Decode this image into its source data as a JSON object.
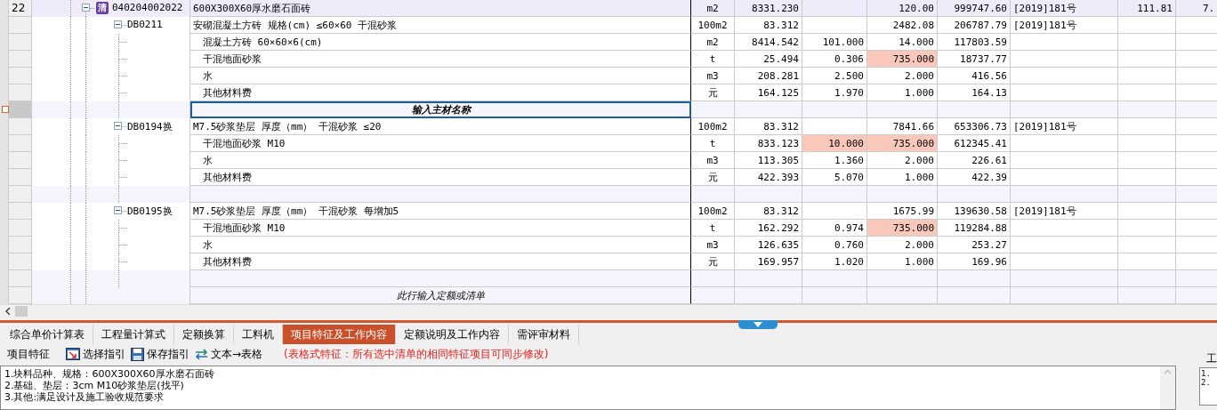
{
  "rows": [
    {
      "kind": "item",
      "row_number": "22",
      "badge": "清",
      "code": "040204002022",
      "expanded": true,
      "selected": false,
      "name": "600X300X60厚水磨石面砖",
      "unit": "m2",
      "quantity": "8331.230",
      "price": "120.00",
      "total": "999747.60",
      "document": "[2019]181号",
      "column_9": "111.81",
      "column_10": "7.",
      "children": [
        {
          "kind": "quota",
          "code": "DB0211",
          "expanded": true,
          "selected": false,
          "name": "安砌混凝土方砖 规格(cm) ≤60×60 干混砂浆",
          "unit": "100m2",
          "quantity": "83.312",
          "price": "2482.08",
          "total": "206787.79",
          "document": "[2019]181号",
          "children": [
            {
              "kind": "material",
              "selected": false,
              "name": "混凝土方砖 60×60×6(cm)",
              "unit": "m2",
              "quantity": "8414.542",
              "column_6": "101.000",
              "column_6_flagged": false,
              "price": "14.000",
              "price_flagged": false,
              "total": "117803.59"
            },
            {
              "kind": "material",
              "selected": false,
              "name": "干混地面砂浆",
              "unit": "t",
              "quantity": "25.494",
              "column_6": "0.306",
              "column_6_flagged": false,
              "price": "735.000",
              "price_flagged": true,
              "total": "18737.77"
            },
            {
              "kind": "material",
              "selected": false,
              "name": "水",
              "unit": "m3",
              "quantity": "208.281",
              "column_6": "2.500",
              "column_6_flagged": false,
              "price": "2.000",
              "price_flagged": false,
              "total": "416.56"
            },
            {
              "kind": "material",
              "selected": false,
              "name": "其他材料费",
              "unit": "元",
              "quantity": "164.125",
              "column_6": "1.970",
              "column_6_flagged": false,
              "price": "1.000",
              "price_flagged": false,
              "total": "164.13"
            },
            {
              "kind": "input",
              "selected": true,
              "name": "输入主材名称"
            }
          ]
        },
        {
          "kind": "quota",
          "code": "DB0194换",
          "expanded": true,
          "selected": false,
          "name": "M7.5砂浆垫层 厚度（mm） 干混砂浆 ≤20",
          "unit": "100m2",
          "quantity": "83.312",
          "price": "7841.66",
          "total": "653306.73",
          "document": "[2019]181号",
          "children": [
            {
              "kind": "material",
              "selected": false,
              "name": "干混地面砂浆 M10",
              "unit": "t",
              "quantity": "833.123",
              "column_6": "10.000",
              "column_6_flagged": true,
              "price": "735.000",
              "price_flagged": true,
              "total": "612345.41"
            },
            {
              "kind": "material",
              "selected": false,
              "name": "水",
              "unit": "m3",
              "quantity": "113.305",
              "column_6": "1.360",
              "column_6_flagged": false,
              "price": "2.000",
              "price_flagged": false,
              "total": "226.61"
            },
            {
              "kind": "material",
              "selected": false,
              "name": "其他材料费",
              "unit": "元",
              "quantity": "422.393",
              "column_6": "5.070",
              "column_6_flagged": false,
              "price": "1.000",
              "price_flagged": false,
              "total": "422.39"
            },
            {
              "kind": "blank",
              "selected": false
            }
          ]
        },
        {
          "kind": "quota",
          "code": "DB0195换",
          "expanded": true,
          "selected": false,
          "name": "M7.5砂浆垫层 厚度（mm） 干混砂浆 每增加5",
          "unit": "100m2",
          "quantity": "83.312",
          "price": "1675.99",
          "total": "139630.58",
          "document": "[2019]181号",
          "children": [
            {
              "kind": "material",
              "selected": false,
              "name": "干混地面砂浆 M10",
              "unit": "t",
              "quantity": "162.292",
              "column_6": "0.974",
              "column_6_flagged": false,
              "price": "735.000",
              "price_flagged": true,
              "total": "119284.88"
            },
            {
              "kind": "material",
              "selected": false,
              "name": "水",
              "unit": "m3",
              "quantity": "126.635",
              "column_6": "0.760",
              "column_6_flagged": false,
              "price": "2.000",
              "price_flagged": false,
              "total": "253.27"
            },
            {
              "kind": "material",
              "selected": false,
              "name": "其他材料费",
              "unit": "元",
              "quantity": "169.957",
              "column_6": "1.020",
              "column_6_flagged": false,
              "price": "1.000",
              "price_flagged": false,
              "total": "169.96"
            },
            {
              "kind": "blank",
              "selected": false
            }
          ]
        },
        {
          "kind": "add",
          "selected": false,
          "name": "此行输入定额或清单"
        }
      ]
    }
  ],
  "tabs": [
    {
      "label": "综合单价计算表",
      "selected": false
    },
    {
      "label": "工程量计算式",
      "selected": false
    },
    {
      "label": "定额换算",
      "selected": false
    },
    {
      "label": "工料机",
      "selected": false
    },
    {
      "label": "项目特征及工作内容",
      "selected": true
    },
    {
      "label": "定额说明及工作内容",
      "selected": false
    },
    {
      "label": "需评审材料",
      "selected": false
    }
  ],
  "toolbar": {
    "title": "项目特征",
    "buttons": [
      {
        "kind": "select",
        "label": "选择指引"
      },
      {
        "kind": "save",
        "label": "保存指引"
      },
      {
        "kind": "convert",
        "label": "文本→表格"
      }
    ],
    "note": "(表格式特征：所有选中清单的相同特征项目可同步修改)"
  },
  "features": [
    "1.块料品种、规格：600X300X60厚水磨石面砖",
    "2.基础、垫层：3cm M10砂浆垫层(找平)",
    "3.其他:满足设计及施工验收规范要求"
  ],
  "side_panel": {
    "title": "工",
    "lines": [
      "1.",
      "2."
    ]
  }
}
